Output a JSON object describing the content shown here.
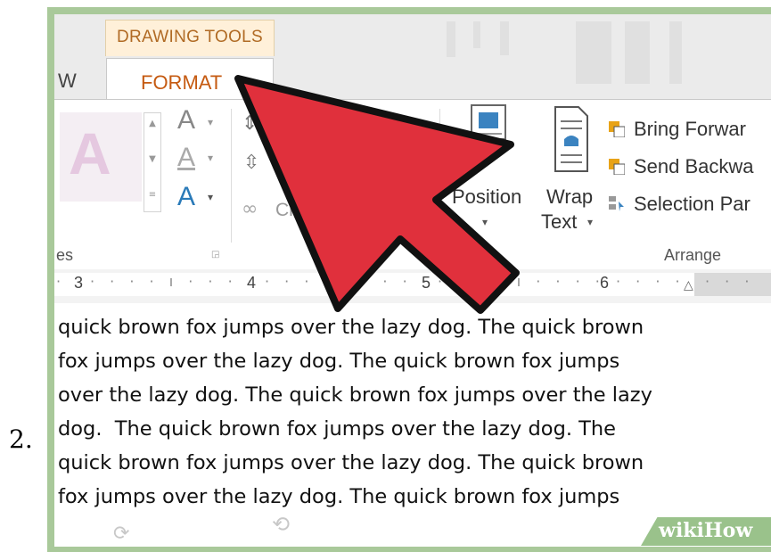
{
  "step_number": "2.",
  "tabs": {
    "contextual_label": "DRAWING TOOLS",
    "active_tab": "FORMAT",
    "partial_tab": "W"
  },
  "ribbon": {
    "style_preview": "A",
    "format_letters": [
      "A",
      "A",
      "A"
    ],
    "crop_partial": "Cr",
    "position_label": "Position",
    "wrap_text_label_1": "Wrap",
    "wrap_text_label_2": "Text",
    "arrange_items": [
      "Bring Forwar",
      "Send Backwa",
      "Selection Par"
    ],
    "group_labels": {
      "styles_partial": "es",
      "arrange": "Arrange"
    }
  },
  "ruler": {
    "numbers": [
      "3",
      "4",
      "5",
      "6"
    ]
  },
  "document": {
    "lines": [
      "quick brown fox jumps over the lazy dog. The quick brown",
      "fox jumps over the lazy dog. The quick brown fox jumps",
      "over the lazy dog. The quick brown fox jumps over the lazy",
      "dog.  The quick brown fox jumps over the lazy dog. The",
      "quick brown fox jumps over the lazy dog. The quick brown",
      "fox jumps over the lazy dog. The quick brown fox jumps"
    ]
  },
  "watermark": "wikiHow",
  "colors": {
    "frame": "#a9c99a",
    "pointer": "#e0303c",
    "tab_text": "#c55a11"
  }
}
